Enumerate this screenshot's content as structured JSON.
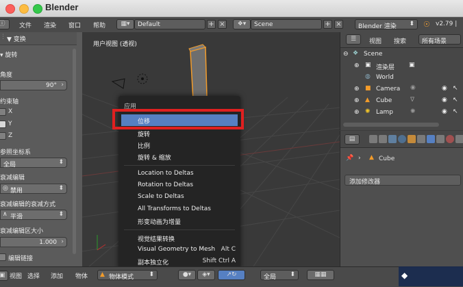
{
  "app": {
    "title": "Blender"
  },
  "info_header": {
    "menus": [
      "文件",
      "渲染",
      "窗口",
      "帮助"
    ],
    "layout": "Default",
    "scene": "Scene",
    "engine": "Blender 渲染",
    "version": "v2.79 |"
  },
  "tool_shelf": {
    "panel_title": "▼ 变换",
    "rotate_label": "旋转",
    "angle_label": "角度",
    "angle_value": "90°",
    "constraint_label": "约束轴",
    "axes": [
      "X",
      "Y",
      "Z"
    ],
    "orientation_label": "参照坐标系",
    "orientation_value": "全局",
    "prop_edit_label": "衰减编辑",
    "prop_edit_value": "禁用",
    "falloff_label": "衰减编辑的衰减方式",
    "falloff_value": "平滑",
    "size_label": "衰减编辑区大小",
    "size_value": "1.000",
    "edit_linked_label": "编辑链接"
  },
  "viewport": {
    "title": "用户视图 (透视)"
  },
  "context_menu": {
    "title": "应用",
    "items": [
      {
        "label": "位移",
        "shortcut": ""
      },
      {
        "label": "旋转",
        "shortcut": ""
      },
      {
        "label": "比例",
        "shortcut": ""
      },
      {
        "label": "旋转 & 缩放",
        "shortcut": ""
      },
      {
        "label": "Location to Deltas",
        "shortcut": ""
      },
      {
        "label": "Rotation to Deltas",
        "shortcut": ""
      },
      {
        "label": "Scale to Deltas",
        "shortcut": ""
      },
      {
        "label": "All Transforms to Deltas",
        "shortcut": ""
      },
      {
        "label": "形变动画为增量",
        "shortcut": ""
      },
      {
        "label": "视觉结果转换",
        "shortcut": ""
      },
      {
        "label": "Visual Geometry to Mesh",
        "shortcut": "Alt C"
      },
      {
        "label": "副本独立化",
        "shortcut": "Shift Ctrl A"
      }
    ]
  },
  "outliner": {
    "view_label": "视图",
    "search_label": "搜索",
    "filter_value": "所有场景",
    "rows": [
      "Scene",
      "渲染层",
      "World",
      "Camera",
      "Cube",
      "Lamp"
    ]
  },
  "properties": {
    "breadcrumb_object": "Cube",
    "add_modifier": "添加修改器"
  },
  "bottom_bar": {
    "view": "视图",
    "select": "选择",
    "add": "添加",
    "object": "物体",
    "mode": "物体模式",
    "pivot": "全局"
  },
  "colors": {
    "highlight": "#5680c2",
    "annotation": "#e02020",
    "selected_object": "#f39c2a"
  }
}
